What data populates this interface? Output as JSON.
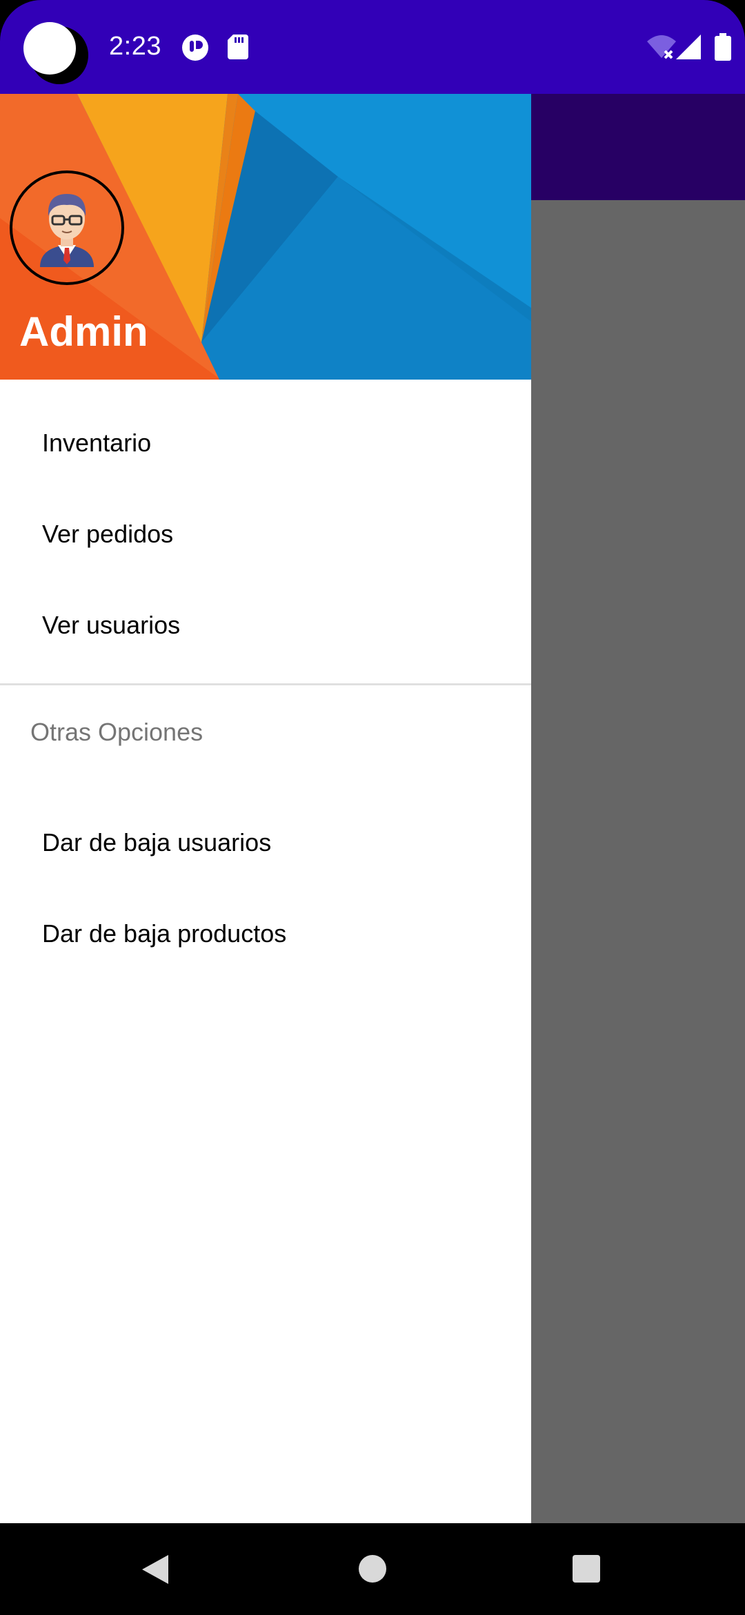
{
  "status_bar": {
    "time": "2:23",
    "icons": [
      "notification-icon",
      "sd-card-icon",
      "wifi-off-icon",
      "cell-signal-icon",
      "battery-icon"
    ],
    "background": "#3200B7"
  },
  "drawer": {
    "header": {
      "title": "Admin",
      "avatar": "person-avatar-icon"
    },
    "items": [
      {
        "label": "Inventario"
      },
      {
        "label": "Ver pedidos"
      },
      {
        "label": "Ver usuarios"
      }
    ],
    "section": {
      "title": "Otras Opciones",
      "items": [
        {
          "label": "Dar de baja usuarios"
        },
        {
          "label": "Dar de baja productos"
        }
      ]
    }
  },
  "app": {
    "toolbar_color": "#270064",
    "scrim_color": "#666666"
  },
  "nav_bar": {
    "buttons": [
      "back-icon",
      "home-icon",
      "recents-icon"
    ]
  }
}
